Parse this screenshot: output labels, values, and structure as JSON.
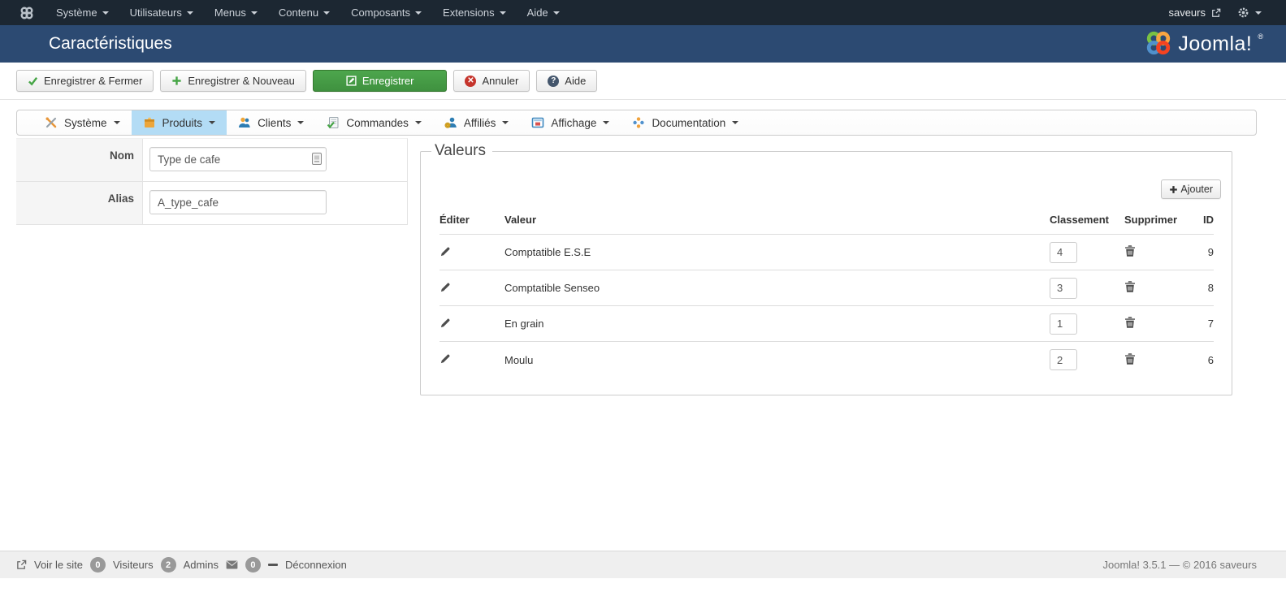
{
  "colors": {
    "topbar_bg": "#1c2732",
    "header_bg": "#2c4a72",
    "accent_green": "#46a546",
    "active_menu_bg": "#b3dcf5",
    "cancel_red": "#c5342c",
    "badge_gray": "#999999",
    "footer_bg": "#efefef"
  },
  "topbar": {
    "menus": [
      "Système",
      "Utilisateurs",
      "Menus",
      "Contenu",
      "Composants",
      "Extensions",
      "Aide"
    ],
    "site_name": "saveurs"
  },
  "header": {
    "title": "Caractéristiques",
    "logo_text": "Joomla!",
    "logo_reg": "®"
  },
  "toolbar": {
    "buttons": [
      "Enregistrer & Fermer",
      "Enregistrer & Nouveau",
      "Enregistrer",
      "Annuler",
      "Aide"
    ]
  },
  "component_menu": {
    "items": [
      "Système",
      "Produits",
      "Clients",
      "Commandes",
      "Affiliés",
      "Affichage",
      "Documentation"
    ],
    "active": "Produits"
  },
  "form": {
    "nom_label": "Nom",
    "nom_value": "Type de cafe",
    "alias_label": "Alias",
    "alias_value": "A_type_cafe"
  },
  "valeurs": {
    "legend": "Valeurs",
    "add_label": "Ajouter",
    "headers": [
      "Éditer",
      "Valeur",
      "Classement",
      "Supprimer",
      "ID"
    ],
    "rows": [
      {
        "valeur": "Comptatible E.S.E",
        "classement": "4",
        "id": "9"
      },
      {
        "valeur": "Comptatible Senseo",
        "classement": "3",
        "id": "8"
      },
      {
        "valeur": "En grain",
        "classement": "1",
        "id": "7"
      },
      {
        "valeur": "Moulu",
        "classement": "2",
        "id": "6"
      }
    ]
  },
  "footer": {
    "view_site": "Voir le site",
    "visitors_count": "0",
    "visitors_label": "Visiteurs",
    "admins_count": "2",
    "admins_label": "Admins",
    "messages_count": "0",
    "logout": "Déconnexion",
    "version": "Joomla! 3.5.1 — © 2016 saveurs"
  },
  "icons": {
    "joomla-icon": "joomla pinwheel glyph",
    "joomla-logo-emblem": "4-color joomla pinwheel",
    "external-link-icon": "box with arrow",
    "gear-icon": "⚙",
    "chevron-down-icon": "▾",
    "check-icon": "✔",
    "plus-icon": "+",
    "edit-icon": "square with pencil",
    "cancel-icon": "✕",
    "help-icon": "?",
    "tools-icon": "crossed tools",
    "box-icon": "orange product box",
    "user-icon": "person",
    "orders-icon": "document with green check",
    "affiliate-icon": "person with coin",
    "display-icon": "browser window",
    "documentation-icon": "color pinwheel",
    "translate-icon": "small input sheet",
    "pencil-icon": "✎",
    "trash-icon": "trash can",
    "envelope-icon": "✉",
    "logout-dash-icon": "—"
  }
}
